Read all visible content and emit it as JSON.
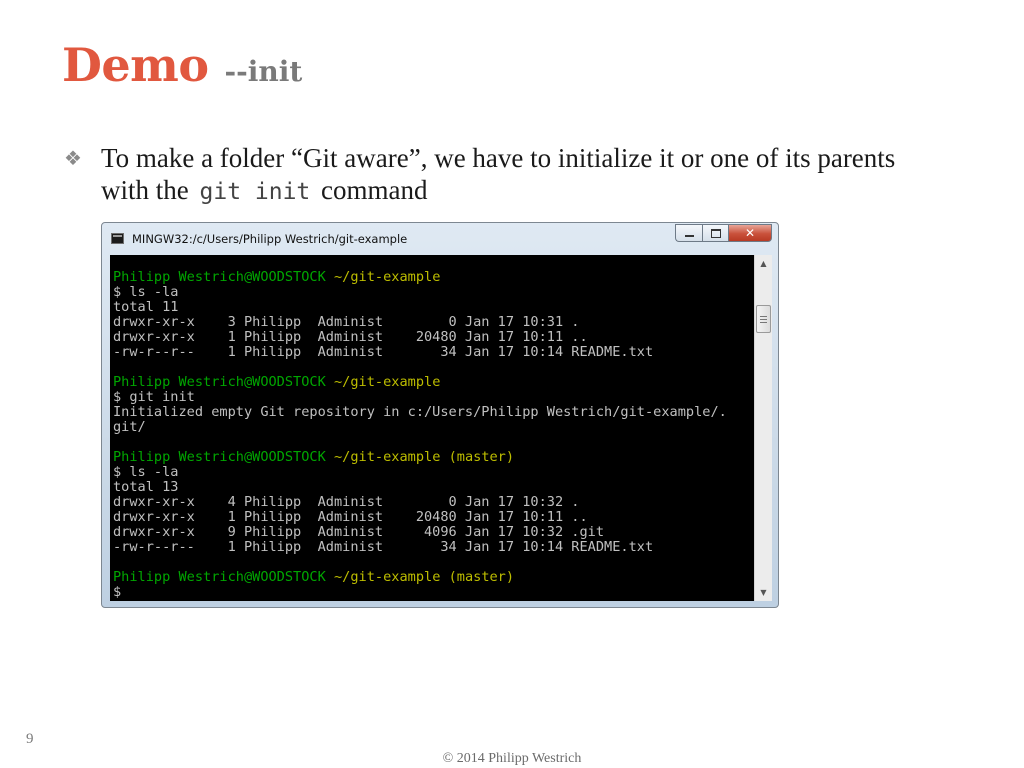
{
  "slide": {
    "title": "Demo",
    "subtitle": "--init",
    "bullet": {
      "text_before": "To make a folder “Git aware”, we have to initialize it or one of its parents with the",
      "code": "git init",
      "text_after": "command"
    },
    "page_number": "9",
    "footer": "© 2014 Philipp Westrich"
  },
  "window": {
    "title": "MINGW32:/c/Users/Philipp Westrich/git-example",
    "controls": {
      "minimize": "minimize",
      "maximize": "maximize",
      "close": "✕"
    },
    "app_icon": "terminal-icon"
  },
  "terminal": {
    "colors": {
      "background": "#000000",
      "text": "#c0c0c0",
      "user": "#00a600",
      "path": "#bdbd00"
    },
    "lines": [
      {
        "type": "prompt",
        "user": "Philipp Westrich@WOODSTOCK",
        "path": "~/git-example",
        "branch": ""
      },
      {
        "type": "out",
        "text": "$ ls -la"
      },
      {
        "type": "out",
        "text": "total 11"
      },
      {
        "type": "out",
        "text": "drwxr-xr-x    3 Philipp  Administ        0 Jan 17 10:31 ."
      },
      {
        "type": "out",
        "text": "drwxr-xr-x    1 Philipp  Administ    20480 Jan 17 10:11 .."
      },
      {
        "type": "out",
        "text": "-rw-r--r--    1 Philipp  Administ       34 Jan 17 10:14 README.txt"
      },
      {
        "type": "out",
        "text": ""
      },
      {
        "type": "prompt",
        "user": "Philipp Westrich@WOODSTOCK",
        "path": "~/git-example",
        "branch": ""
      },
      {
        "type": "out",
        "text": "$ git init"
      },
      {
        "type": "out",
        "text": "Initialized empty Git repository in c:/Users/Philipp Westrich/git-example/."
      },
      {
        "type": "out",
        "text": "git/"
      },
      {
        "type": "out",
        "text": ""
      },
      {
        "type": "prompt",
        "user": "Philipp Westrich@WOODSTOCK",
        "path": "~/git-example",
        "branch": "(master)"
      },
      {
        "type": "out",
        "text": "$ ls -la"
      },
      {
        "type": "out",
        "text": "total 13"
      },
      {
        "type": "out",
        "text": "drwxr-xr-x    4 Philipp  Administ        0 Jan 17 10:32 ."
      },
      {
        "type": "out",
        "text": "drwxr-xr-x    1 Philipp  Administ    20480 Jan 17 10:11 .."
      },
      {
        "type": "out",
        "text": "drwxr-xr-x    9 Philipp  Administ     4096 Jan 17 10:32 .git"
      },
      {
        "type": "out",
        "text": "-rw-r--r--    1 Philipp  Administ       34 Jan 17 10:14 README.txt"
      },
      {
        "type": "out",
        "text": ""
      },
      {
        "type": "prompt",
        "user": "Philipp Westrich@WOODSTOCK",
        "path": "~/git-example",
        "branch": "(master)"
      },
      {
        "type": "out",
        "text": "$"
      }
    ]
  },
  "scrollbar": {
    "up_icon": "scroll-up-arrow-icon",
    "down_icon": "scroll-down-arrow-icon",
    "position": "top"
  }
}
